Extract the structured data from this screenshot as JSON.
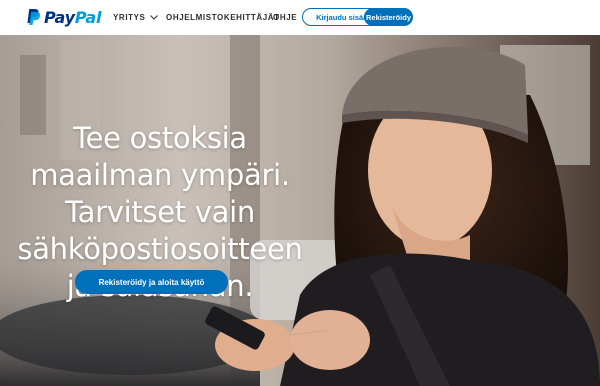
{
  "brand": {
    "name_part1": "Pay",
    "name_part2": "Pal"
  },
  "nav": {
    "company_label": "YRITYS",
    "developers_label": "OHJELMISTOKEHITTÄJÄT",
    "help_label": "OHJE",
    "login_label": "Kirjaudu sisään",
    "signup_label": "Rekisteröidy"
  },
  "hero": {
    "title": "Tee ostoksia maailman ympäri. Tarvitset vain sähköpostiosoitteen ja salasanan.",
    "cta_label": "Rekisteröidy ja aloita käyttö"
  },
  "colors": {
    "primary": "#0070ba",
    "brand_dark": "#003087",
    "brand_light": "#009cde"
  }
}
